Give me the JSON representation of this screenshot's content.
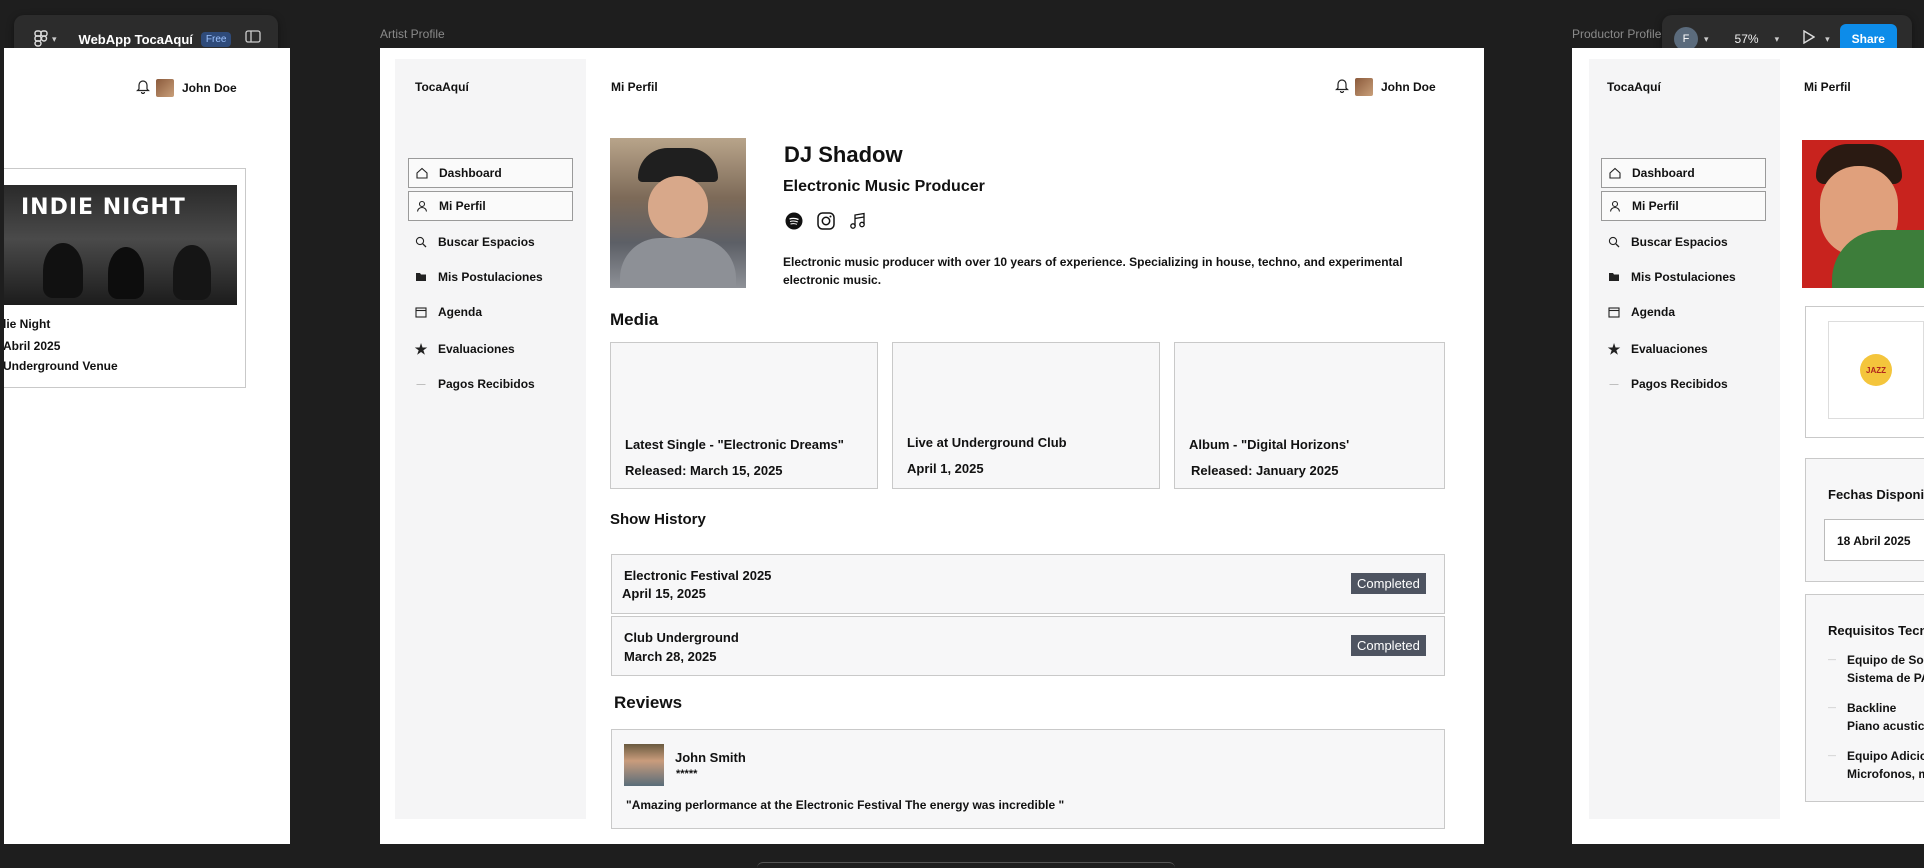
{
  "toolbar": {
    "file_title": "WebApp TocaAquí",
    "plan_badge": "Free",
    "user_initial": "F",
    "zoom": "57%",
    "share_label": "Share"
  },
  "frames": {
    "artist_label": "Artist Profile",
    "productor_label": "Productor Profile"
  },
  "left_frame": {
    "user_name": "John Doe",
    "poster_title": "INDIE NIGHT",
    "event_name": "lie Night",
    "event_date": "Abril 2025",
    "event_venue": "Underground Venue"
  },
  "app": {
    "brand": "TocaAquí",
    "page_title": "Mi Perfil",
    "user_name": "John Doe",
    "nav": [
      {
        "label": "Dashboard",
        "icon": "home-icon"
      },
      {
        "label": "Mi Perfil",
        "icon": "user-icon"
      },
      {
        "label": "Buscar Espacios",
        "icon": "search-icon"
      },
      {
        "label": "Mis Postulaciones",
        "icon": "folder-icon"
      },
      {
        "label": "Agenda",
        "icon": "calendar-icon"
      },
      {
        "label": "Evaluaciones",
        "icon": "star-icon"
      },
      {
        "label": "Pagos Recibidos",
        "icon": "payment-icon"
      }
    ]
  },
  "profile": {
    "name": "DJ Shadow",
    "role": "Electronic Music Producer",
    "bio_line1": "Electronic music producer with over 10 years of experience. Specializing in house, techno, and experimental",
    "bio_line2": "electronic music.",
    "socials": [
      "spotify-icon",
      "instagram-icon",
      "music-note-icon"
    ]
  },
  "media": {
    "heading": "Media",
    "items": [
      {
        "title": "Latest Single - \"Electronic Dreams\"",
        "subtitle": "Released: March 15, 2025"
      },
      {
        "title": "Live at Underground Club",
        "subtitle": "April 1, 2025"
      },
      {
        "title": "Album - \"Digital Horizons'",
        "subtitle": "Released: January 2025"
      }
    ]
  },
  "shows": {
    "heading": "Show History",
    "items": [
      {
        "name": "Electronic Festival 2025",
        "date": "April 15, 2025",
        "status": "Completed"
      },
      {
        "name": "Club Underground",
        "date": "March 28, 2025",
        "status": "Completed"
      }
    ]
  },
  "reviews": {
    "heading": "Reviews",
    "items": [
      {
        "author": "John Smith",
        "rating": "*****",
        "text": "\"Amazing perlormance at the Electronic Festival  The energy was incredible \""
      }
    ]
  },
  "right_frame": {
    "dates_heading": "Fechas Disponib",
    "date_value": "18 Abril 2025",
    "req_heading": "Requisitos Tecni",
    "reqs": [
      {
        "title": "Equipo de So",
        "detail": "Sistema de PA"
      },
      {
        "title": "Backline",
        "detail": "Piano acustic"
      },
      {
        "title": "Equipo Adicic",
        "detail": "Microfonos, m"
      }
    ],
    "logo_text": "JAZZ"
  },
  "colors": {
    "canvas": "#1e1e1e",
    "toolbar": "#2c2c2c",
    "share": "#0d8ce9",
    "badge": "#4e5461",
    "sidebar": "#f5f5f6"
  }
}
